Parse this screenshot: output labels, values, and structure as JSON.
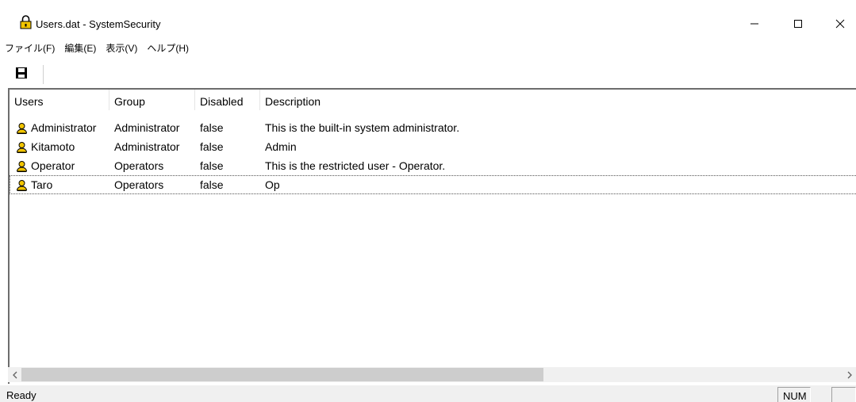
{
  "window": {
    "title": "Users.dat - SystemSecurity",
    "app_icon": "padlock-icon",
    "controls": {
      "minimize": "minimize-icon",
      "maximize": "maximize-icon",
      "close": "close-icon"
    }
  },
  "menu": {
    "items": [
      {
        "label": "ファイル(F)"
      },
      {
        "label": "編集(E)"
      },
      {
        "label": "表示(V)"
      },
      {
        "label": "ヘルプ(H)"
      }
    ]
  },
  "toolbar": {
    "save_icon": "floppy-disk-icon"
  },
  "list": {
    "columns": [
      "Users",
      "Group",
      "Disabled",
      "Description"
    ],
    "rows": [
      {
        "user": "Administrator",
        "group": "Administrator",
        "disabled": "false",
        "description": "This is the built-in system administrator."
      },
      {
        "user": "Kitamoto",
        "group": "Administrator",
        "disabled": "false",
        "description": "Admin"
      },
      {
        "user": "Operator",
        "group": "Operators",
        "disabled": "false",
        "description": "This is the restricted user - Operator."
      },
      {
        "user": "Taro",
        "group": "Operators",
        "disabled": "false",
        "description": "Op"
      }
    ],
    "row_icon": "user-icon",
    "focused_row": 3
  },
  "status": {
    "text": "Ready",
    "num": "NUM"
  },
  "colors": {
    "border_dark": "#6d6d6d",
    "scrollbar_bg": "#f0f0f0",
    "scroll_thumb": "#cdcdcd",
    "icon_yellow": "#f2c500"
  }
}
